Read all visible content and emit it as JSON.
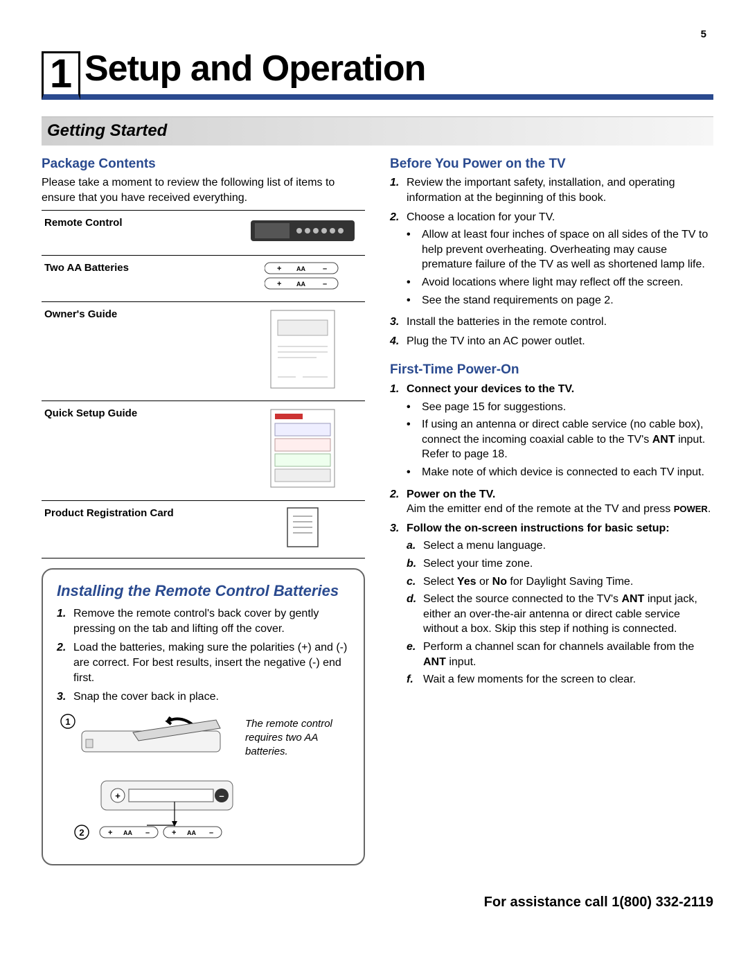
{
  "page_number": "5",
  "chapter_number": "1",
  "chapter_title": "Setup and Operation",
  "section_title": "Getting Started",
  "left": {
    "package_heading": "Package Contents",
    "package_intro": "Please take a moment to review the following list of items to ensure that you have received everything.",
    "items": [
      "Remote Control",
      "Two AA Batteries",
      "Owner's Guide",
      "Quick Setup Guide",
      "Product Registration Card"
    ],
    "callout_title": "Installing the Remote Control Batteries",
    "callout_steps": [
      "Remove the remote control's back cover by gently pressing on the tab and lifting off the cover.",
      "Load the batteries, making sure the polarities (+) and (-) are correct.  For best results, insert the negative (-) end first.",
      "Snap the cover back in place."
    ],
    "diagram_caption": "The remote control requires two AA batteries.",
    "diagram_num1": "1",
    "diagram_num2": "2",
    "aa_label": "AA"
  },
  "right": {
    "before_heading": "Before You Power on the TV",
    "before_steps": [
      {
        "n": "1.",
        "text": "Review the important safety, installation, and operating information at the beginning of this book."
      },
      {
        "n": "2.",
        "text": "Choose a location for your TV.",
        "bullets": [
          "Allow at least four inches of space on all sides of the TV to help prevent overheating.  Overheating may cause premature failure of the TV as well as shortened lamp life.",
          "Avoid locations where light may reflect off the screen.",
          "See the stand requirements on page 2."
        ]
      },
      {
        "n": "3.",
        "text": "Install the batteries in the remote control."
      },
      {
        "n": "4.",
        "text": "Plug the TV into an AC power outlet."
      }
    ],
    "first_heading": "First-Time Power-On",
    "first_steps": {
      "s1_n": "1.",
      "s1_title": "Connect your devices to the TV.",
      "s1_bullets": [
        "See page 15 for suggestions."
      ],
      "s1_b2_pre": "If using an antenna or direct cable service (no cable box), connect the incoming coaxial cable to the TV's ",
      "s1_b2_bold": "ANT",
      "s1_b2_post": " input.  Refer to page 18.",
      "s1_b3": "Make note of which device is connected to each TV input.",
      "s2_n": "2.",
      "s2_title": "Power on the TV.",
      "s2_text_pre": "Aim the emitter end of the remote at the TV and press ",
      "s2_text_bold": "POWER",
      "s2_text_post": ".",
      "s3_n": "3.",
      "s3_title": "Follow the on-screen instructions for basic setup:",
      "s3_a": "Select a menu language.",
      "s3_b": "Select your time zone.",
      "s3_c_pre": "Select ",
      "s3_c_yes": "Yes",
      "s3_c_mid": " or ",
      "s3_c_no": "No",
      "s3_c_post": " for Daylight Saving Time.",
      "s3_d_pre": "Select the source connected to the TV's ",
      "s3_d_bold": "ANT",
      "s3_d_post": " input jack, either an over-the-air antenna or direct cable service without a box.  Skip this step if nothing is connected.",
      "s3_e_pre": "Perform a channel scan for channels available from the ",
      "s3_e_bold": "ANT",
      "s3_e_post": " input.",
      "s3_f": "Wait a few moments for the screen to clear."
    }
  },
  "footer": "For assistance call 1(800) 332-2119"
}
